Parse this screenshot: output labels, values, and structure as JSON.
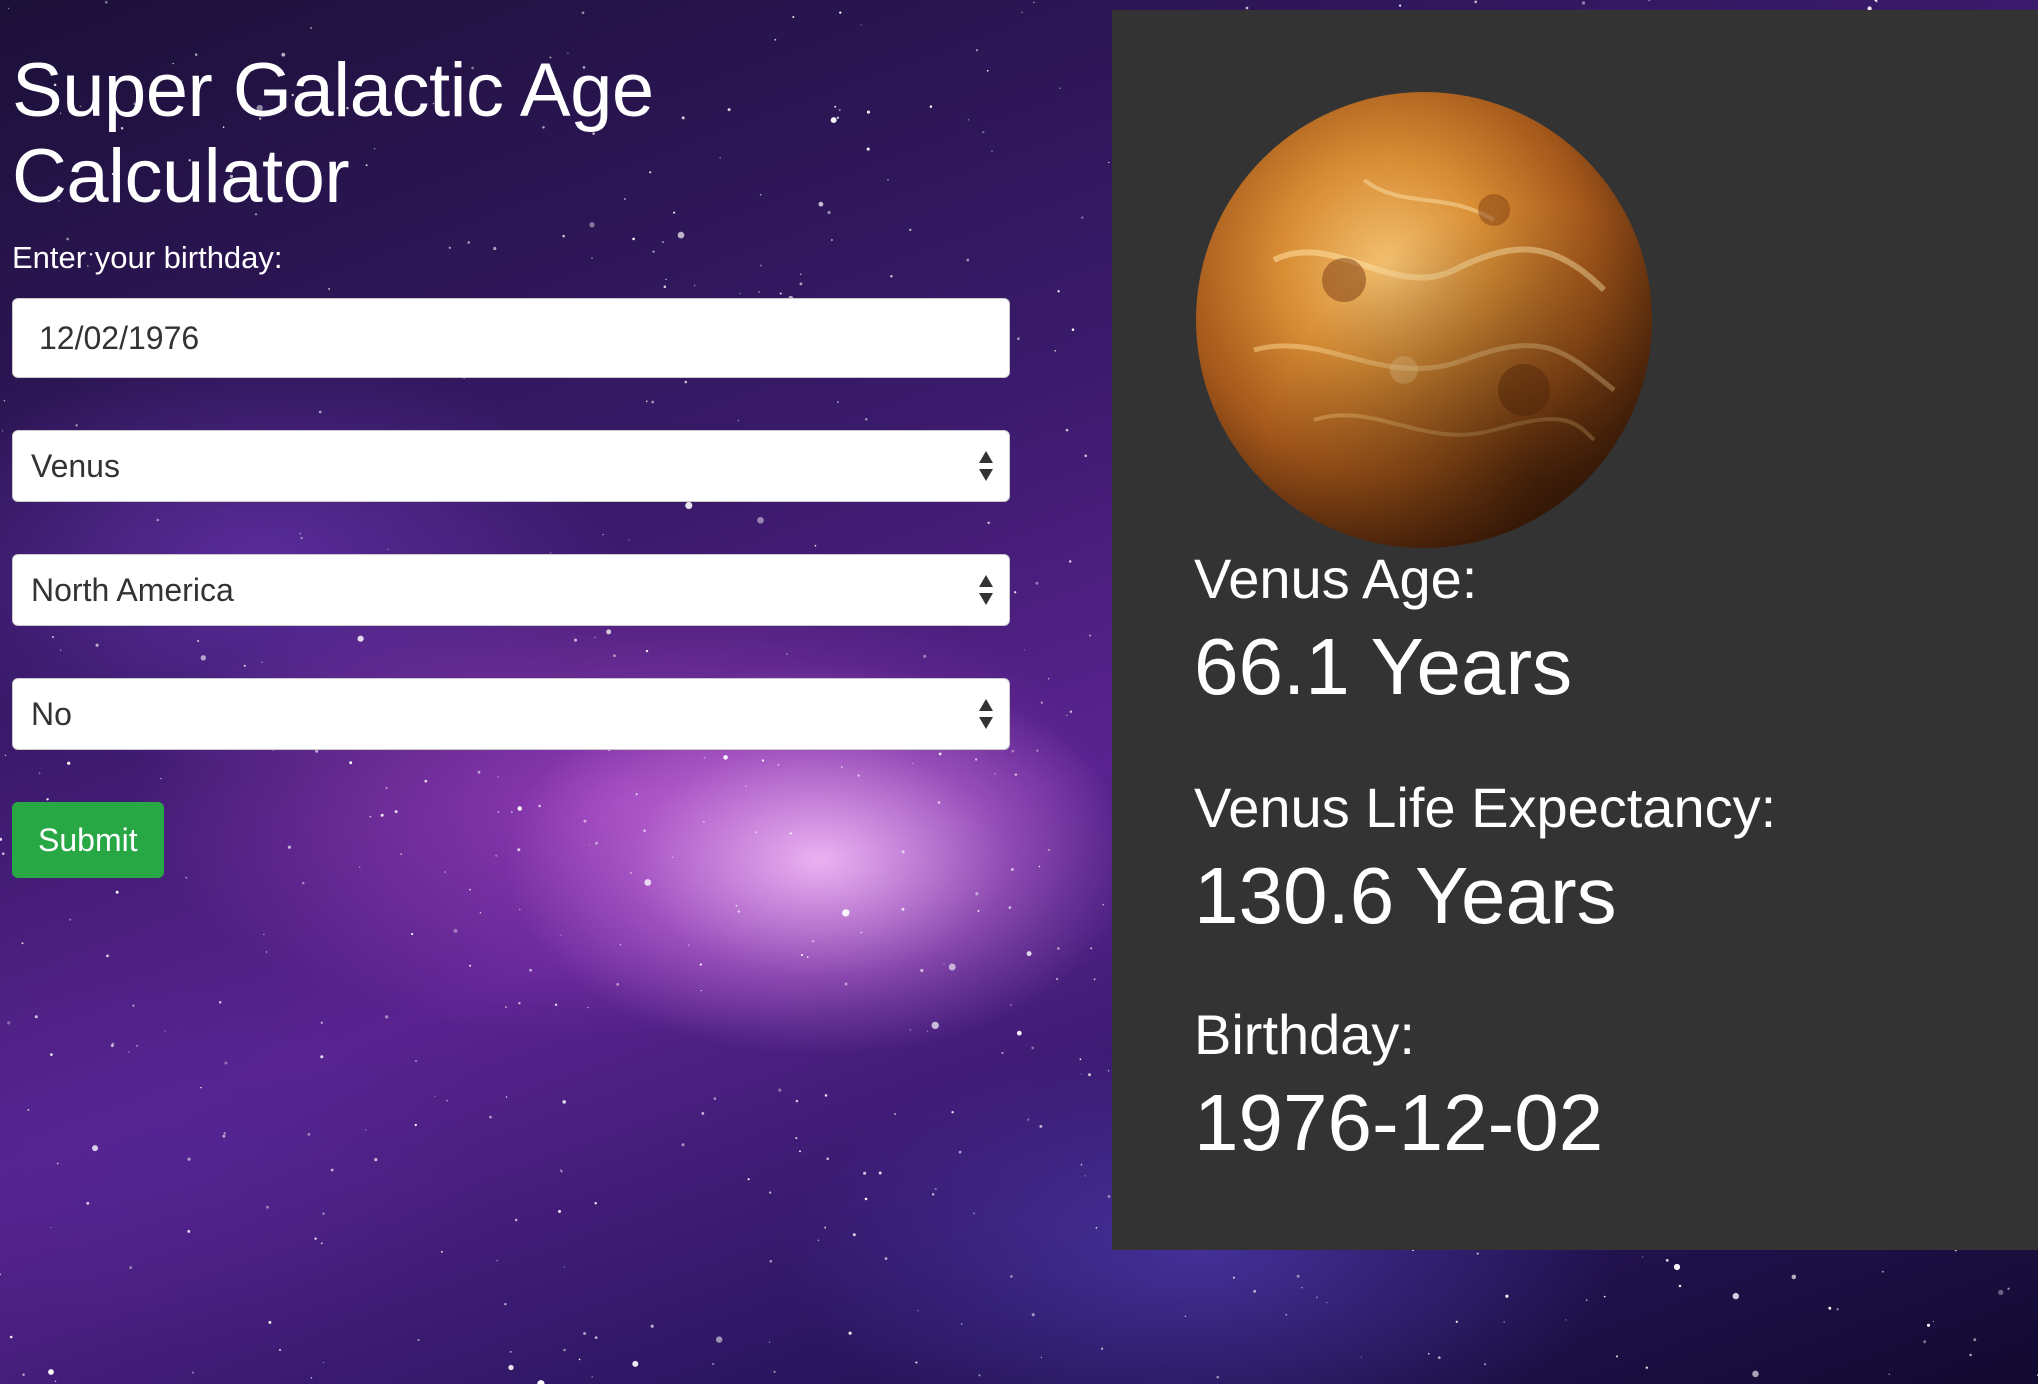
{
  "app": {
    "title": "Super Galactic Age Calculator"
  },
  "form": {
    "birthday_label": "Enter your birthday:",
    "birthday_value": "12/02/1976",
    "planet_select": {
      "selected": "Venus"
    },
    "region_select": {
      "selected": "North America"
    },
    "third_select": {
      "selected": "No"
    },
    "submit_label": "Submit",
    "submit_color": "#28a745"
  },
  "results": {
    "panel_color": "#333333",
    "planet_image_icon": "venus-planet-icon",
    "age_label": "Venus Age:",
    "age_value": "66.1 Years",
    "life_expectancy_label": "Venus Life Expectancy:",
    "life_expectancy_value": "130.6 Years",
    "birthday_label": "Birthday:",
    "birthday_value": "1976-12-02"
  }
}
